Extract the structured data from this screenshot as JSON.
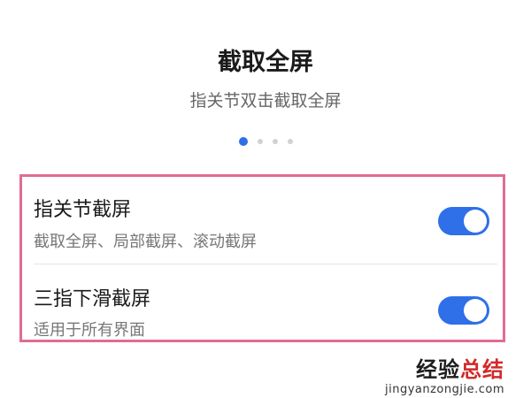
{
  "header": {
    "title": "截取全屏",
    "subtitle": "指关节双击截取全屏"
  },
  "carousel": {
    "page_count": 4,
    "active_index": 0
  },
  "settings": [
    {
      "label": "指关节截屏",
      "description": "截取全屏、局部截屏、滚动截屏",
      "enabled": true
    },
    {
      "label": "三指下滑截屏",
      "description": "适用于所有界面",
      "enabled": true
    }
  ],
  "watermark": {
    "title_part1": "经验",
    "title_part2": "总结",
    "url": "jingyanzongjie.com"
  },
  "colors": {
    "accent": "#2f6fe8",
    "highlight_border": "#e06c96",
    "watermark_red": "#d12a2a"
  }
}
